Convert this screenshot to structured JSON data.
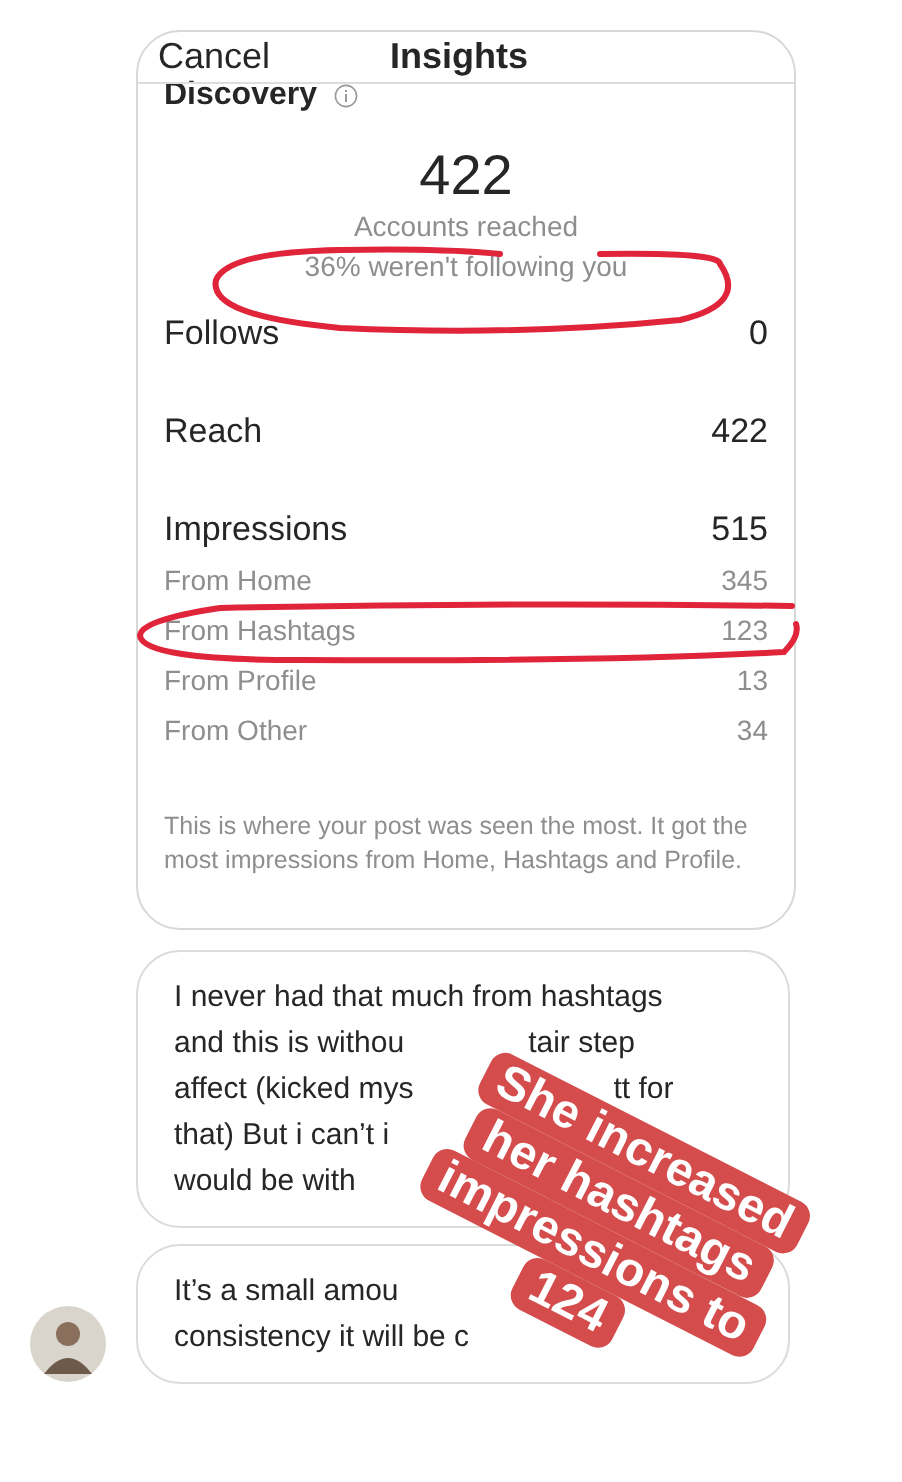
{
  "header": {
    "cancel": "Cancel",
    "title": "Insights"
  },
  "section": {
    "title": "Discovery"
  },
  "highlight": {
    "value": "422",
    "label": "Accounts reached",
    "note": "36% weren't following you"
  },
  "metrics": [
    {
      "kind": "main",
      "label": "Follows",
      "value": "0"
    },
    {
      "kind": "main",
      "label": "Reach",
      "value": "422"
    },
    {
      "kind": "main",
      "label": "Impressions",
      "value": "515"
    },
    {
      "kind": "sub",
      "label": "From Home",
      "value": "345"
    },
    {
      "kind": "sub",
      "label": "From Hashtags",
      "value": "123"
    },
    {
      "kind": "sub",
      "label": "From Profile",
      "value": "13"
    },
    {
      "kind": "sub",
      "label": "From Other",
      "value": "34"
    }
  ],
  "footnote": "This is where your post was seen the most. It got the most impressions from Home, Hashtags and Profile.",
  "messages": [
    {
      "avatar": false,
      "lines": [
        [
          "I never had that much from hashtags"
        ],
        [
          "and this is withou",
          "tair step"
        ],
        [
          "affect (kicked mys",
          "tt for"
        ],
        [
          "that) But i can’t i"
        ],
        [
          "would be with"
        ]
      ]
    },
    {
      "avatar": true,
      "lines": [
        [
          "It’s a small amou"
        ],
        [
          "consistency it will be c"
        ]
      ]
    }
  ],
  "sticker": [
    "She increased",
    "her hashtags",
    "impressions to",
    "124"
  ]
}
